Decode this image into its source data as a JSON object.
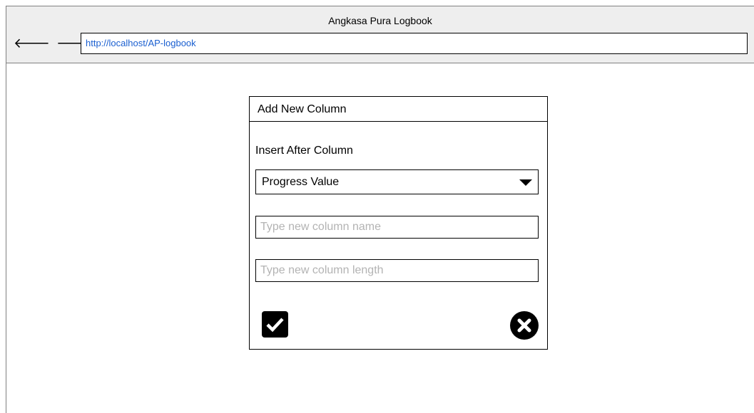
{
  "window": {
    "title": "Angkasa Pura Logbook"
  },
  "nav": {
    "back_glyph": "🡐",
    "forward_glyph": "🡒",
    "reload_glyph": "⟳",
    "url": "http://localhost/AP-logbook"
  },
  "dialog": {
    "title": "Add New Column",
    "insert_label": "Insert After Column",
    "selected_column": "Progress Value",
    "name_placeholder": "Type new column name",
    "length_placeholder": "Type new column length",
    "confirm_icon": "check-icon",
    "cancel_icon": "close-circle-icon"
  }
}
